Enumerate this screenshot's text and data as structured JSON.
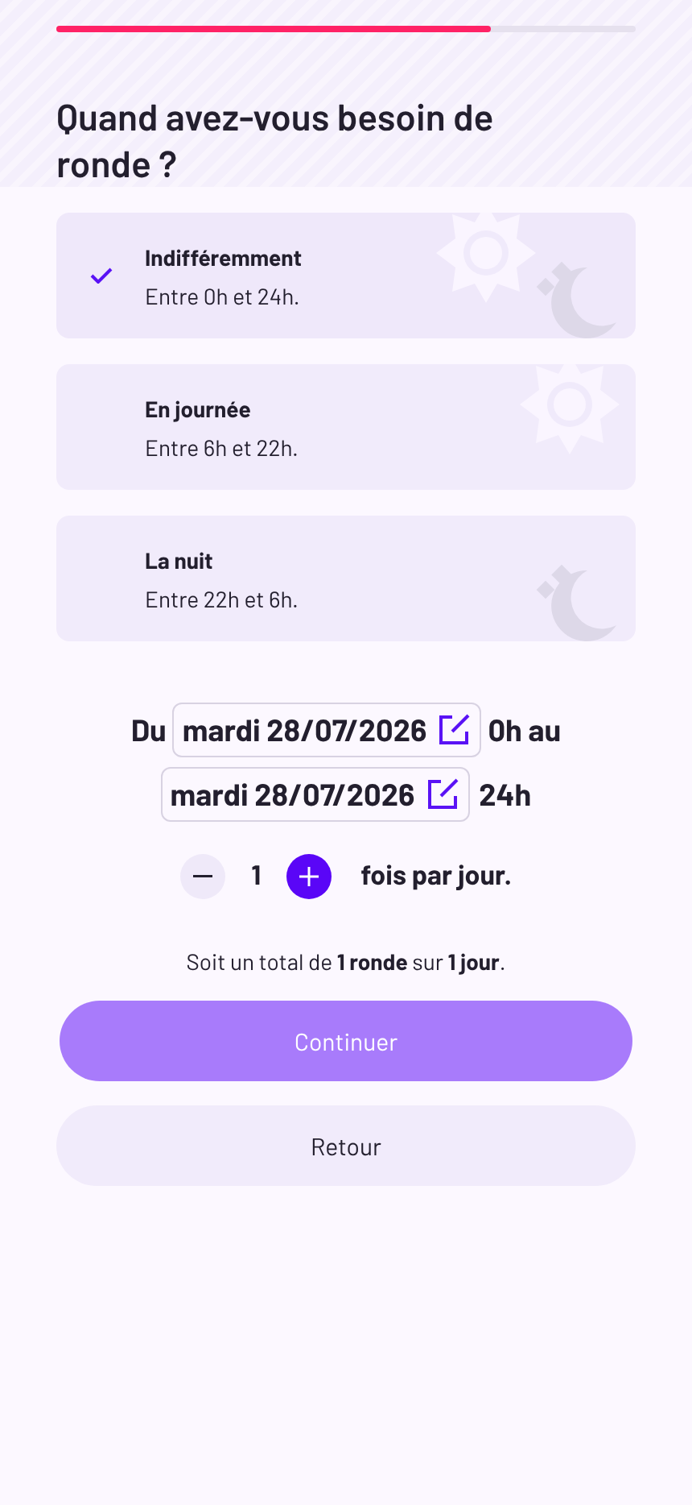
{
  "progress": {
    "level": 0.75
  },
  "title": "Quand avez-vous besoin de ronde ?",
  "options": [
    {
      "label": "Indifféremment",
      "detail": "Entre 0h et 24h.",
      "selected": true,
      "kind": "both"
    },
    {
      "label": "En journée",
      "detail": "Entre 6h et 22h.",
      "selected": false,
      "kind": "sun"
    },
    {
      "label": "La nuit",
      "detail": "Entre 22h et 6h.",
      "selected": false,
      "kind": "moon"
    }
  ],
  "range": {
    "from_label": "Du",
    "start_date": "mardi 28/07/2026",
    "start_hour": "0h au",
    "end_date": "mardi 28/07/2026",
    "end_hour": "24h"
  },
  "counter": {
    "value": "1",
    "suffix": "fois par jour."
  },
  "summary": "Soit un total de **1 ronde** sur **1 jour**.",
  "buttons": {
    "primary": "Continuer",
    "secondary": "Retour"
  }
}
